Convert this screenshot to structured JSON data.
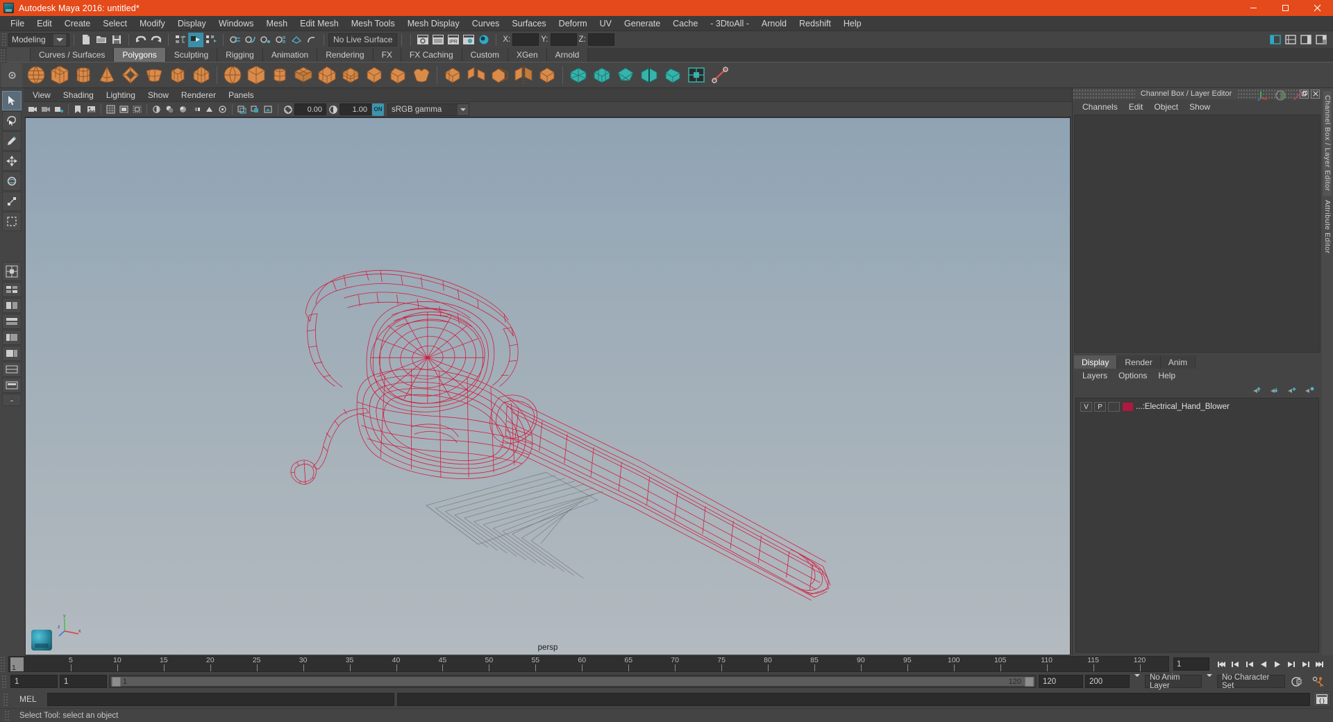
{
  "window": {
    "title": "Autodesk Maya 2016: untitled*",
    "logo_icon": "maya-logo-icon",
    "minimize_icon": "minimize-icon",
    "maximize_icon": "maximize-icon",
    "close_icon": "close-icon"
  },
  "menubar": {
    "items": [
      "File",
      "Edit",
      "Create",
      "Select",
      "Modify",
      "Display",
      "Windows",
      "Mesh",
      "Edit Mesh",
      "Mesh Tools",
      "Mesh Display",
      "Curves",
      "Surfaces",
      "Deform",
      "UV",
      "Generate",
      "Cache",
      "- 3DtoAll -",
      "Arnold",
      "Redshift",
      "Help"
    ]
  },
  "statusbar": {
    "menuset": {
      "value": "Modeling",
      "dropdown_icon": "chevron-down-icon"
    },
    "file_icons": [
      "new-scene-icon",
      "open-scene-icon",
      "save-scene-icon"
    ],
    "history_icons": [
      "undo-icon",
      "redo-icon"
    ],
    "select_mode_icons": [
      "select-by-hierarchy-icon",
      "select-by-object-icon",
      "select-by-component-icon"
    ],
    "snap_icons": [
      "snap-to-grid-icon",
      "snap-to-curve-icon",
      "snap-to-point-icon",
      "snap-to-projected-center-icon",
      "snap-to-view-plane-icon",
      "make-live-icon"
    ],
    "live_surface": {
      "label": "No Live Surface"
    },
    "render_icons": [
      "render-current-frame-icon",
      "render-sequence-icon",
      "ipr-render-icon",
      "render-settings-icon",
      "hypershade-icon"
    ],
    "coords": {
      "x_label": "X:",
      "x_value": "",
      "y_label": "Y:",
      "y_value": "",
      "z_label": "Z:",
      "z_value": ""
    },
    "right_icons": [
      "show-attribute-editor-icon",
      "show-tool-settings-icon",
      "show-channel-box-icon",
      "show-layer-editor-icon"
    ]
  },
  "shelf": {
    "tabs": [
      {
        "label": "Curves / Surfaces",
        "active": false
      },
      {
        "label": "Polygons",
        "active": true
      },
      {
        "label": "Sculpting",
        "active": false
      },
      {
        "label": "Rigging",
        "active": false
      },
      {
        "label": "Animation",
        "active": false
      },
      {
        "label": "Rendering",
        "active": false
      },
      {
        "label": "FX",
        "active": false
      },
      {
        "label": "FX Caching",
        "active": false
      },
      {
        "label": "Custom",
        "active": false
      },
      {
        "label": "XGen",
        "active": false
      },
      {
        "label": "Arnold",
        "active": false
      }
    ],
    "icons": [
      "polygon-sphere-icon",
      "polygon-cube-icon",
      "polygon-cylinder-icon",
      "polygon-cone-icon",
      "polygon-torus-icon",
      "polygon-plane-icon",
      "polygon-pipe-icon",
      "polygon-prism-icon",
      "sphere-smooth-icon",
      "cube-smooth-icon",
      "soup-can-icon",
      "poly-grid-icon",
      "poly-platonic-icon",
      "poly-helix-icon",
      "poly-extrude-icon",
      "poly-bevel-icon",
      "poly-bridge-icon",
      "poly-append-icon",
      "poly-combine-icon",
      "poly-separate-icon",
      "poly-boolean-icon",
      "poly-mirror-icon",
      "poly-smooth-icon",
      "poly-triangulate-icon",
      "poly-quadrangulate-icon",
      "poly-reduce-icon",
      "uv-editor-icon",
      "poly-cut-icon"
    ]
  },
  "toolbox": {
    "tools": [
      {
        "name": "select-tool",
        "selected": true
      },
      {
        "name": "lasso-select-tool",
        "selected": false
      },
      {
        "name": "paint-select-tool",
        "selected": false
      },
      {
        "name": "move-tool",
        "selected": false
      },
      {
        "name": "rotate-tool",
        "selected": false
      },
      {
        "name": "scale-tool",
        "selected": false
      },
      {
        "name": "last-tool-used",
        "selected": false
      }
    ],
    "layouts": [
      "single-perspective-layout",
      "four-view-layout",
      "persp-outliner-layout",
      "persp-graph-layout",
      "hypershade-persp-layout",
      "persp-side-layout",
      "outliner-persp-layout",
      "two-stacked-layout",
      "more-layouts"
    ]
  },
  "viewport": {
    "menus": [
      "View",
      "Shading",
      "Lighting",
      "Show",
      "Renderer",
      "Panels"
    ],
    "toolbar": {
      "exposure_value": "0.00",
      "gamma_value": "1.00",
      "color_management": "sRGB gamma",
      "cm_toggle_label": "ON",
      "icons": [
        "select-camera-icon",
        "lock-camera-icon",
        "camera-attributes-icon",
        "bookmarks-icon",
        "image-plane-icon",
        "two-sided-lighting-icon",
        "shadows-icon",
        "screen-space-ao-icon",
        "motion-blur-icon",
        "multisample-aa-icon",
        "depth-of-field-icon",
        "grid-icon",
        "film-gate-icon",
        "resolution-gate-icon",
        "gate-mask-icon",
        "xray-icon",
        "xray-joints-icon",
        "xray-active-components-icon",
        "exposure-icon",
        "gamma-icon"
      ]
    },
    "camera_label": "persp",
    "axis_labels": {
      "x": "x",
      "y": "y",
      "z": "z"
    },
    "object_color": "#d11a3a",
    "grid_color": "#6b6f6e",
    "bg_top": "#8fa3b4",
    "bg_bottom": "#b3bac0",
    "scene_object": "Electrical Hand Blower wireframe"
  },
  "channelbox": {
    "panel_title": "Channel Box / Layer Editor",
    "float_icon": "undock-icon",
    "close_icon": "close-panel-icon",
    "menus": [
      "Channels",
      "Edit",
      "Object",
      "Show"
    ],
    "quick_icons": [
      "move-axis-icon",
      "sphere-shading-icon",
      "slash-icon"
    ]
  },
  "layereditor": {
    "tabs": [
      {
        "label": "Display",
        "active": true
      },
      {
        "label": "Render",
        "active": false
      },
      {
        "label": "Anim",
        "active": false
      }
    ],
    "menus": [
      "Layers",
      "Options",
      "Help"
    ],
    "toolbar_icons": [
      "move-layer-up-icon",
      "move-layer-down-icon",
      "new-layer-icon",
      "new-layer-from-selected-icon"
    ],
    "layers": [
      {
        "visibility": "V",
        "playback": "P",
        "shading": "",
        "color": "#b01840",
        "name": "...:Electrical_Hand_Blower"
      }
    ]
  },
  "vertical_tabs": [
    {
      "label": "Channel Box / Layer Editor",
      "selected": true
    },
    {
      "label": "Attribute Editor",
      "selected": false
    }
  ],
  "timeslider": {
    "start_frame": "1",
    "current_frame": "1",
    "ticks": [
      5,
      10,
      15,
      20,
      25,
      30,
      35,
      40,
      45,
      50,
      55,
      60,
      65,
      70,
      75,
      80,
      85,
      90,
      95,
      100,
      105,
      110,
      115,
      120
    ],
    "range_end": 120,
    "frame_field": "1",
    "transport_icons": [
      "go-to-start-icon",
      "step-back-keyframe-icon",
      "step-back-frame-icon",
      "play-backwards-icon",
      "play-forwards-icon",
      "step-forward-frame-icon",
      "step-forward-keyframe-icon",
      "go-to-end-icon"
    ]
  },
  "rangeslider": {
    "anim_start": "1",
    "range_start": "1",
    "bar_left_label": "1",
    "bar_right_label": "120",
    "range_end": "120",
    "anim_end": "200",
    "anim_layer": "No Anim Layer",
    "character_set": "No Character Set",
    "auto_key_icon": "auto-keyframe-icon",
    "anim_prefs_icon": "animation-preferences-icon",
    "dropdown_icon": "chevron-down-icon"
  },
  "commandline": {
    "label": "MEL",
    "input_value": "",
    "output_value": "",
    "script_editor_icon": "script-editor-icon"
  },
  "helpline": {
    "text": "Select Tool: select an object"
  },
  "colors": {
    "accent_orange": "#e44a1a",
    "accent_teal": "#3f93ab",
    "panel_bg": "#444444",
    "dark_bg": "#2b2b2b",
    "shelf_orange": "#d98b49",
    "wireframe_red": "#d11a3a"
  }
}
